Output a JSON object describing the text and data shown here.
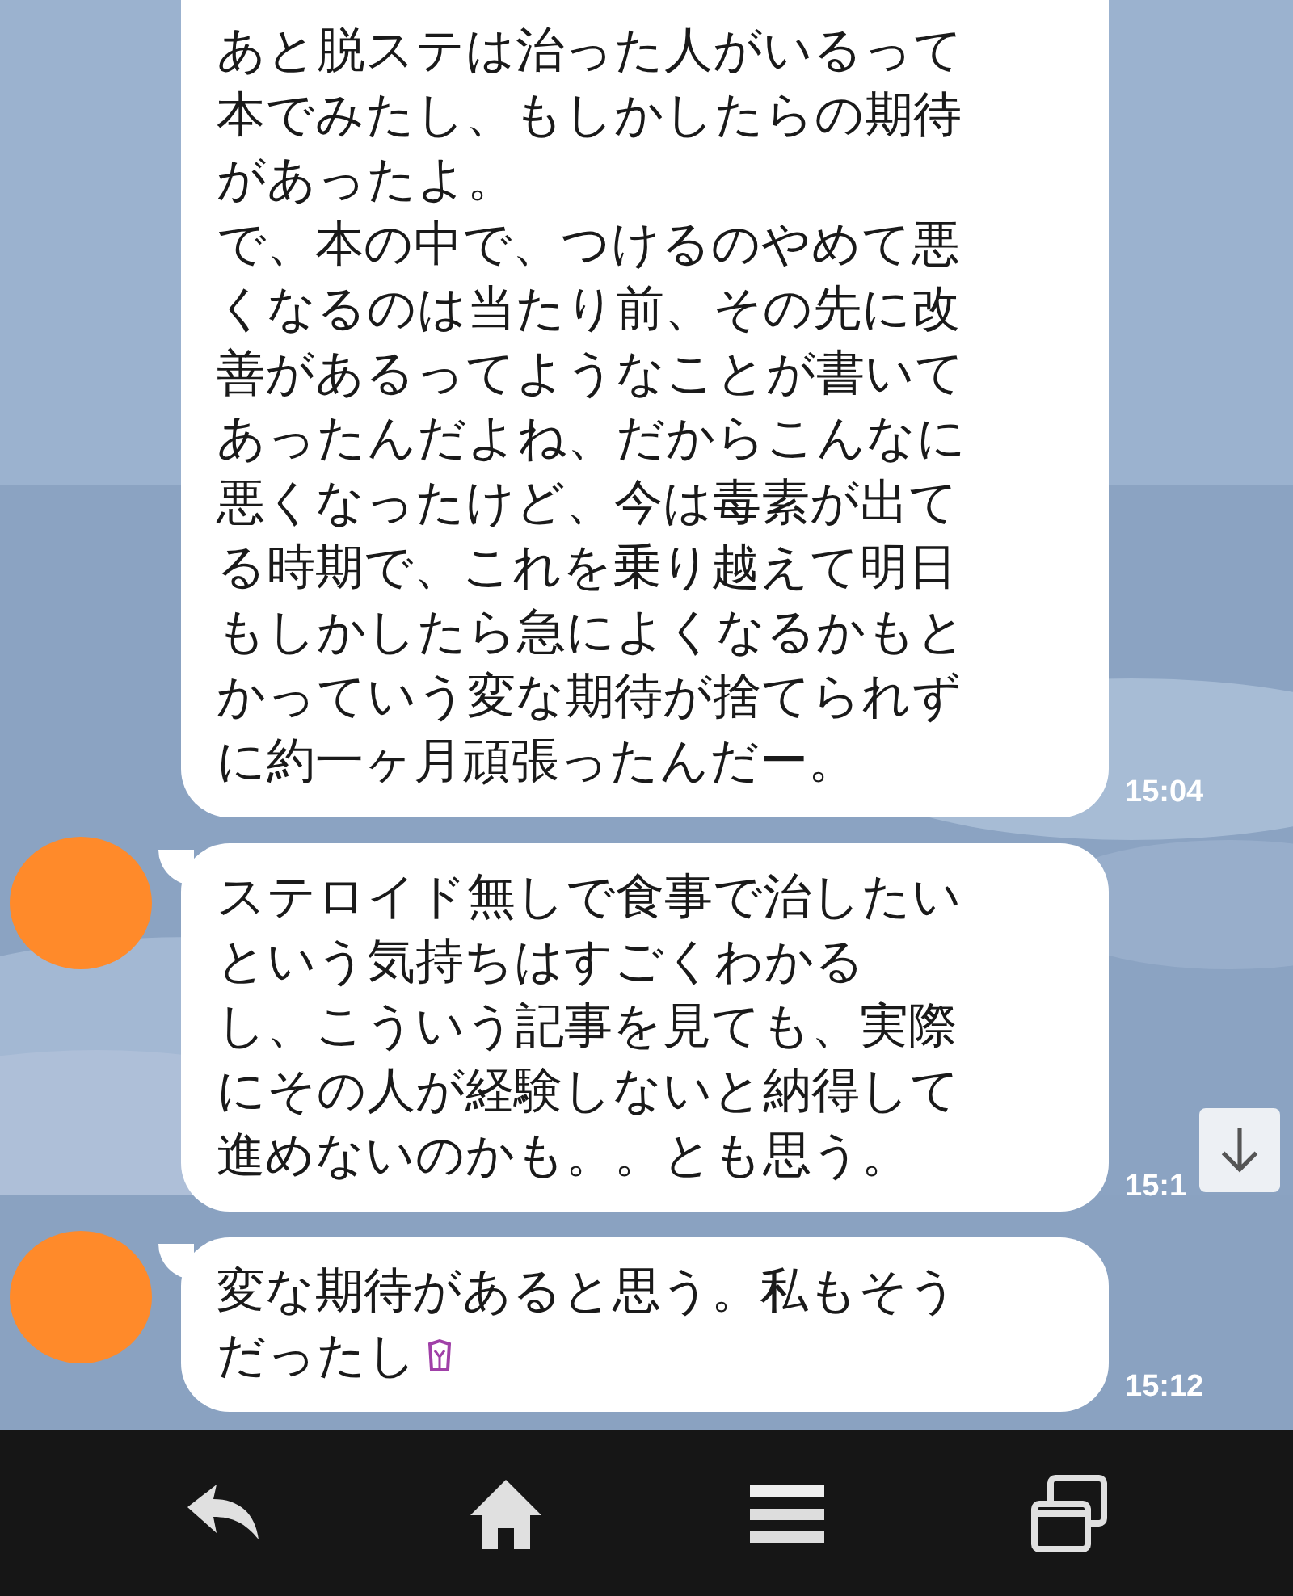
{
  "messages": [
    {
      "show_avatar": false,
      "lines": [
        "あと脱ステは治った人がいるって",
        "本でみたし、もしかしたらの期待",
        "があったよ。",
        "で、本の中で、つけるのやめて悪",
        "くなるのは当たり前、その先に改",
        "善があるってようなことが書いて",
        "あったんだよね、だからこんなに",
        "悪くなったけど、今は毒素が出て",
        "る時期で、これを乗り越えて明日",
        "もしかしたら急によくなるかもと",
        "かっていう変な期待が捨てられず",
        "に約一ヶ月頑張ったんだー。"
      ],
      "time": "15:04",
      "emoji": false
    },
    {
      "show_avatar": true,
      "lines": [
        "ステロイド無しで食事で治したい",
        "という気持ちはすごくわかる",
        "し、こういう記事を見ても、実際",
        "にその人が経験しないと納得して",
        "進めないのかも。。とも思う。"
      ],
      "time": "15:1",
      "emoji": false
    },
    {
      "show_avatar": true,
      "lines": [
        "変な期待があると思う。私もそう",
        "だったし"
      ],
      "time": "15:12",
      "emoji": true
    }
  ],
  "scroll_button": true
}
